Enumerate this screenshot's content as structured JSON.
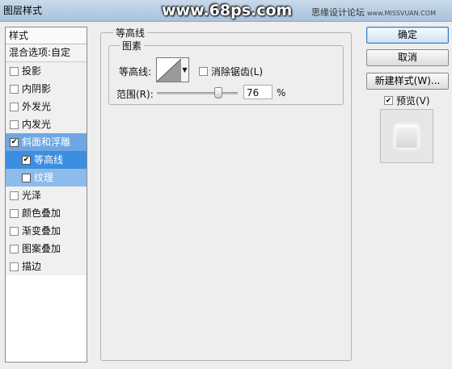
{
  "window": {
    "title": "图层样式",
    "watermark": "www.68ps.com",
    "site_name": "思缘设计论坛",
    "site_url": "www.MISSVUAN.COM"
  },
  "left_panel": {
    "header": "样式",
    "blend_options": "混合选项:自定",
    "items": [
      {
        "label": "投影",
        "checked": false
      },
      {
        "label": "内阴影",
        "checked": false
      },
      {
        "label": "外发光",
        "checked": false
      },
      {
        "label": "内发光",
        "checked": false
      },
      {
        "label": "斜面和浮雕",
        "checked": true
      },
      {
        "label": "等高线",
        "checked": true
      },
      {
        "label": "纹理",
        "checked": false
      },
      {
        "label": "光泽",
        "checked": false
      },
      {
        "label": "颜色叠加",
        "checked": false
      },
      {
        "label": "渐变叠加",
        "checked": false
      },
      {
        "label": "图案叠加",
        "checked": false
      },
      {
        "label": "描边",
        "checked": false
      }
    ]
  },
  "contour_panel": {
    "group_title": "等高线",
    "elements_title": "图素",
    "contour_label": "等高线:",
    "antialias_label": "消除锯齿(L)",
    "antialias_checked": false,
    "range_label": "范围(R):",
    "range_value": "76",
    "range_unit": "%"
  },
  "buttons": {
    "ok": "确定",
    "cancel": "取消",
    "new_style": "新建样式(W)...",
    "preview_label": "预览(V)",
    "preview_checked": true
  },
  "colors": {
    "selected_item": "#6fa7e2",
    "selected_sub": "#3b8ee0",
    "title_bar": "#b7cde4"
  }
}
